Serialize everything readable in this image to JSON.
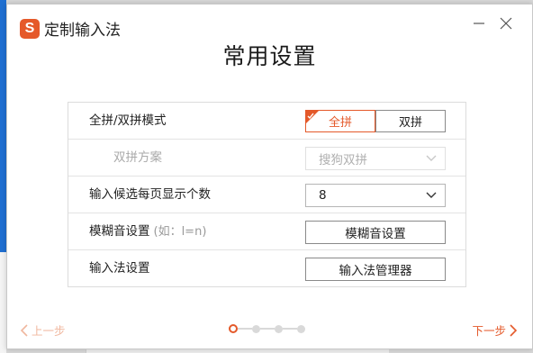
{
  "app": {
    "name": "定制输入法",
    "logo_letter": "S"
  },
  "page": {
    "title": "常用设置"
  },
  "colors": {
    "accent": "#e4592a",
    "border": "#dcdcdc"
  },
  "settings": {
    "mode": {
      "label": "全拼/双拼模式",
      "options": [
        "全拼",
        "双拼"
      ],
      "selected": "全拼"
    },
    "shuangpin": {
      "label": "双拼方案",
      "value": "搜狗双拼",
      "disabled": true
    },
    "candidates": {
      "label": "输入候选每页显示个数",
      "value": "8"
    },
    "fuzzy": {
      "label": "模糊音设置",
      "hint": "(如：l=n)",
      "button": "模糊音设置"
    },
    "ime": {
      "label": "输入法设置",
      "button": "输入法管理器"
    }
  },
  "nav": {
    "prev": "上一步",
    "next": "下一步",
    "step_current": 1,
    "step_total": 4
  }
}
